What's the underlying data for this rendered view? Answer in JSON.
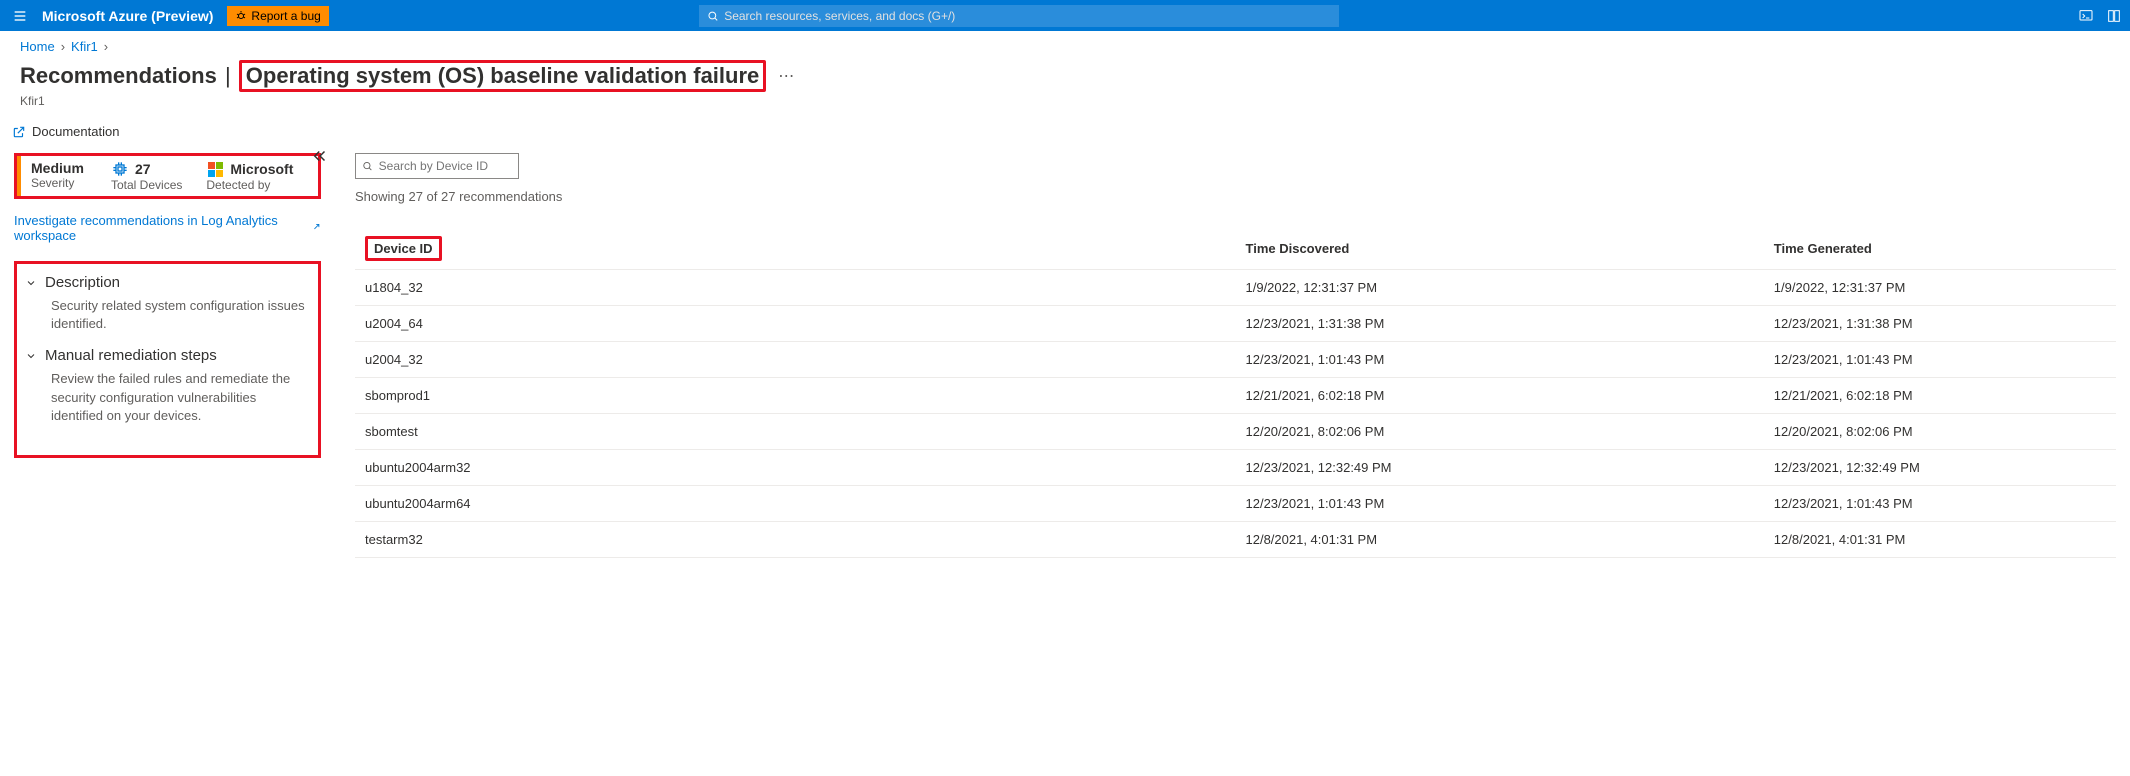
{
  "header": {
    "brand": "Microsoft Azure (Preview)",
    "report_bug_label": "Report a bug",
    "search_placeholder": "Search resources, services, and docs (G+/)"
  },
  "breadcrumb": {
    "items": [
      "Home",
      "Kfir1"
    ]
  },
  "title": {
    "prefix": "Recommendations",
    "main": "Operating system (OS) baseline validation failure",
    "subtitle": "Kfir1"
  },
  "doc_link_label": "Documentation",
  "stats": {
    "severity_value": "Medium",
    "severity_label": "Severity",
    "total_devices_value": "27",
    "total_devices_label": "Total Devices",
    "detected_by_value": "Microsoft",
    "detected_by_label": "Detected by"
  },
  "investigate_link": "Investigate recommendations in Log Analytics workspace",
  "sections": {
    "description_title": "Description",
    "description_body": "Security related system configuration issues identified.",
    "remediation_title": "Manual remediation steps",
    "remediation_body": "Review the failed rules and remediate the security configuration vulnerabilities identified on your devices."
  },
  "filter": {
    "placeholder": "Search by Device ID"
  },
  "showing_text": "Showing 27 of 27 recommendations",
  "table": {
    "columns": [
      "Device ID",
      "Time Discovered",
      "Time Generated"
    ],
    "rows": [
      {
        "device_id": "u1804_32",
        "time_discovered": "1/9/2022, 12:31:37 PM",
        "time_generated": "1/9/2022, 12:31:37 PM"
      },
      {
        "device_id": "u2004_64",
        "time_discovered": "12/23/2021, 1:31:38 PM",
        "time_generated": "12/23/2021, 1:31:38 PM"
      },
      {
        "device_id": "u2004_32",
        "time_discovered": "12/23/2021, 1:01:43 PM",
        "time_generated": "12/23/2021, 1:01:43 PM"
      },
      {
        "device_id": "sbomprod1",
        "time_discovered": "12/21/2021, 6:02:18 PM",
        "time_generated": "12/21/2021, 6:02:18 PM"
      },
      {
        "device_id": "sbomtest",
        "time_discovered": "12/20/2021, 8:02:06 PM",
        "time_generated": "12/20/2021, 8:02:06 PM"
      },
      {
        "device_id": "ubuntu2004arm32",
        "time_discovered": "12/23/2021, 12:32:49 PM",
        "time_generated": "12/23/2021, 12:32:49 PM"
      },
      {
        "device_id": "ubuntu2004arm64",
        "time_discovered": "12/23/2021, 1:01:43 PM",
        "time_generated": "12/23/2021, 1:01:43 PM"
      },
      {
        "device_id": "testarm32",
        "time_discovered": "12/8/2021, 4:01:31 PM",
        "time_generated": "12/8/2021, 4:01:31 PM"
      }
    ]
  }
}
